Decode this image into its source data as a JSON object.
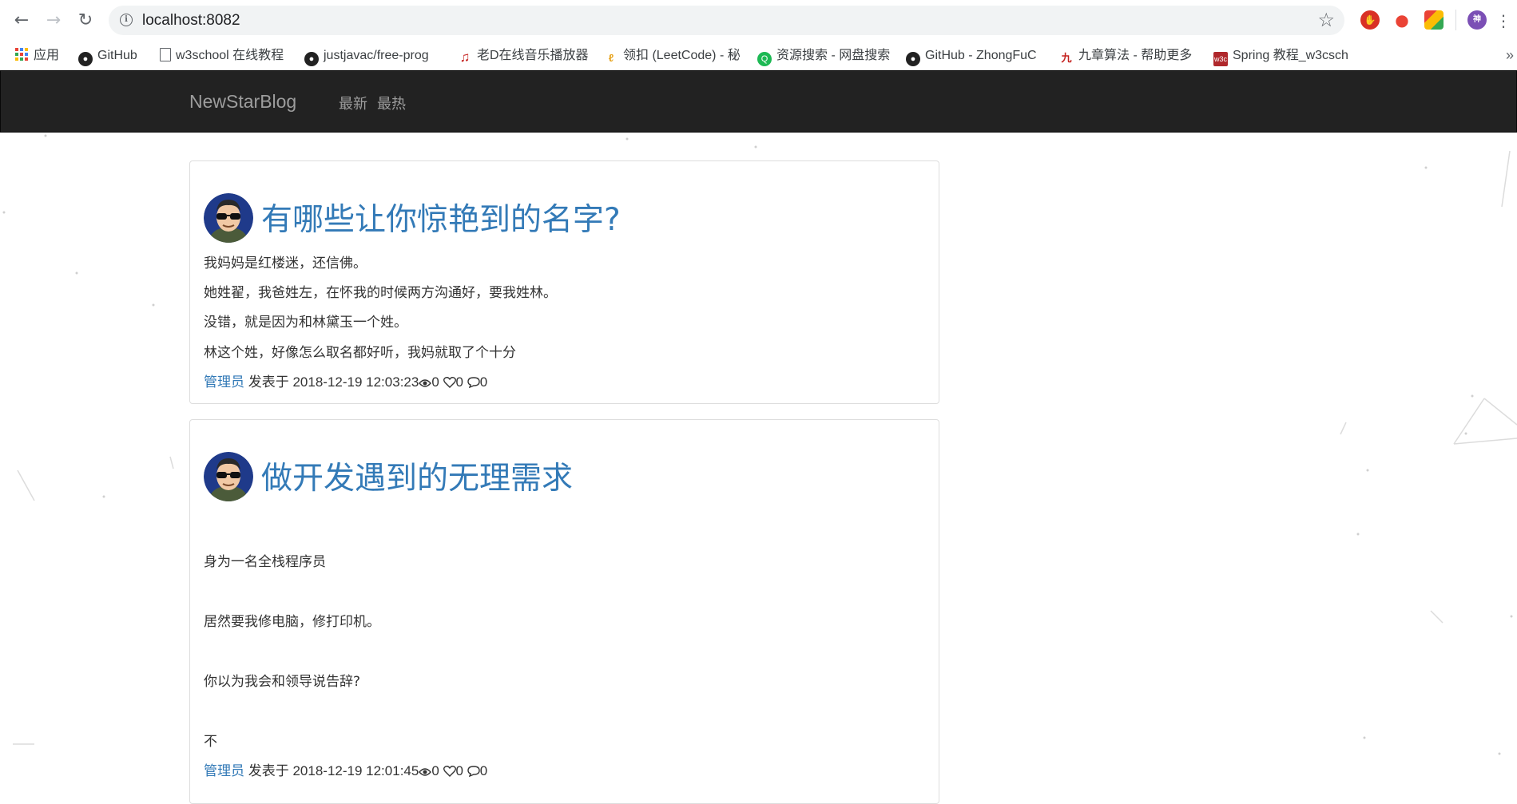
{
  "browser": {
    "url": "localhost:8082",
    "extensions": [
      {
        "name": "shield-extension-icon",
        "color": "#d93025",
        "glyph": "✋"
      },
      {
        "name": "location-extension-icon",
        "color": "#ea4335",
        "glyph": "⬤"
      },
      {
        "name": "drive-extension-icon",
        "color": "#34a853",
        "glyph": "◆"
      },
      {
        "name": "profile-avatar-icon",
        "color": "#7b4fb5",
        "glyph": "神"
      }
    ]
  },
  "bookmarks": [
    {
      "label": "应用",
      "icon": "apps-grid-icon"
    },
    {
      "label": "GitHub",
      "icon": "github-icon"
    },
    {
      "label": "w3school 在线教程",
      "icon": "page-icon"
    },
    {
      "label": "justjavac/free-prog",
      "icon": "github-icon"
    },
    {
      "label": "老D在线音乐播放器",
      "icon": "music-note-icon"
    },
    {
      "label": "领扣 (LeetCode) - 秘",
      "icon": "leetcode-icon"
    },
    {
      "label": "资源搜索 - 网盘搜索",
      "icon": "search-q-icon"
    },
    {
      "label": "GitHub - ZhongFuC",
      "icon": "github-icon"
    },
    {
      "label": "九章算法 - 帮助更多",
      "icon": "jiuzhang-icon"
    },
    {
      "label": "Spring 教程_w3csch",
      "icon": "w3c-icon"
    }
  ],
  "navbar": {
    "brand": "NewStarBlog",
    "links": [
      "最新",
      "最热"
    ]
  },
  "posts": [
    {
      "title": "有哪些让你惊艳到的名字?",
      "paragraphs": [
        "我妈妈是红楼迷，还信佛。",
        "她姓翟，我爸姓左，在怀我的时候两方沟通好，要我姓林。",
        "没错，就是因为和林黛玉一个姓。",
        "林这个姓，好像怎么取名都好听，我妈就取了个十分"
      ],
      "author": "管理员",
      "published_prefix": "发表于",
      "date": "2018-12-19 12:03:23",
      "views": "0",
      "likes": "0",
      "comments": "0"
    },
    {
      "title": "做开发遇到的无理需求",
      "paragraphs": [
        "身为一名全栈程序员",
        "居然要我修电脑，修打印机。",
        "你以为我会和领导说告辞?",
        "不"
      ],
      "author": "管理员",
      "published_prefix": "发表于",
      "date": "2018-12-19 12:01:45",
      "views": "0",
      "likes": "0",
      "comments": "0"
    }
  ],
  "colors": {
    "link": "#337ab7",
    "navbar_bg": "#222222",
    "navbar_text": "#9d9d9d"
  }
}
